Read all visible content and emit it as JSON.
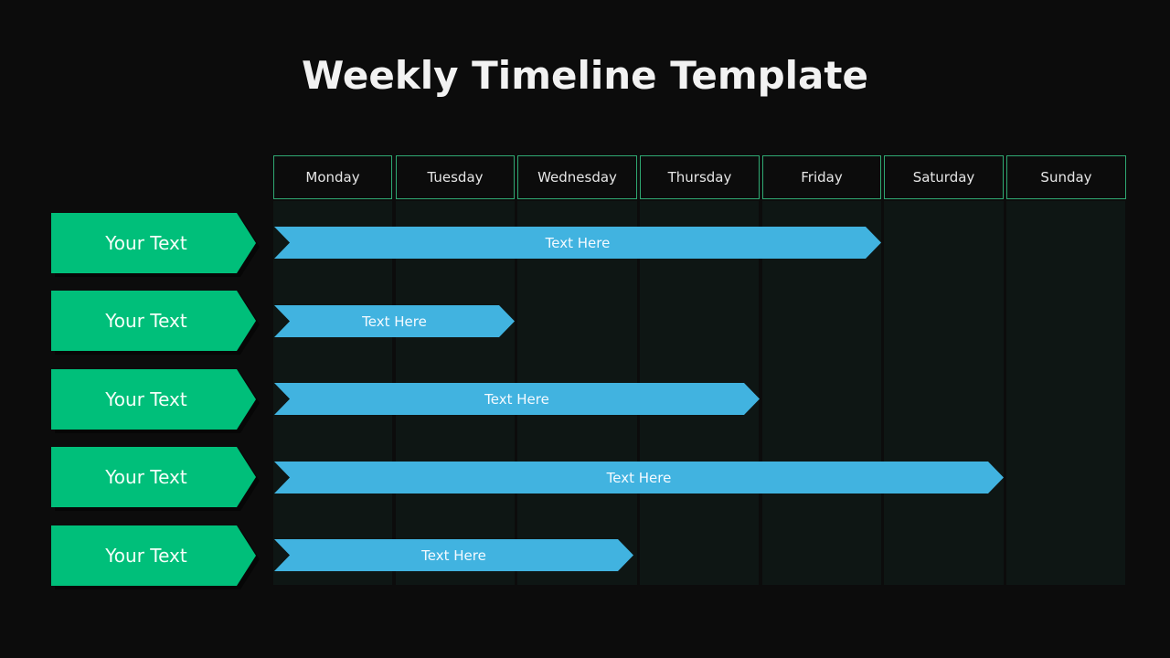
{
  "title": "Weekly Timeline Template",
  "days": [
    "Monday",
    "Tuesday",
    "Wednesday",
    "Thursday",
    "Friday",
    "Saturday",
    "Sunday"
  ],
  "rows": [
    {
      "label": "Your Text",
      "bar_text": "Text Here",
      "start_day": "Monday",
      "end_day": "Friday"
    },
    {
      "label": "Your Text",
      "bar_text": "Text Here",
      "start_day": "Monday",
      "end_day": "Tuesday"
    },
    {
      "label": "Your Text",
      "bar_text": "Text Here",
      "start_day": "Monday",
      "end_day": "Thursday"
    },
    {
      "label": "Your Text",
      "bar_text": "Text Here",
      "start_day": "Monday",
      "end_day": "Saturday"
    },
    {
      "label": "Your Text",
      "bar_text": "Text Here",
      "start_day": "Monday",
      "end_day": "Wednesday (partial)"
    }
  ],
  "colors": {
    "label_fill": "#00bf7a",
    "bar_fill": "#41b3e0",
    "header_border": "#2fa872",
    "background": "#0c0c0c"
  }
}
